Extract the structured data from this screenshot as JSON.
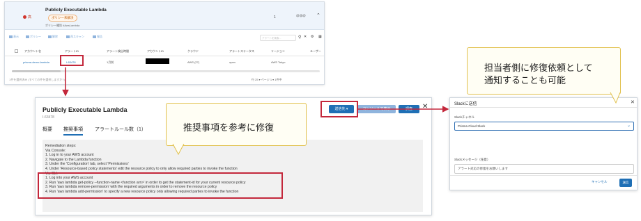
{
  "top_panel": {
    "header": {
      "severity_label": "高",
      "title": "Publicly Executable Lambda",
      "badge": "ポリシー未解決",
      "subline": "ポリシー種別 #AwsLambda",
      "count": "1",
      "count_badge": "@@@"
    },
    "toolbar": {
      "items": [
        "表示",
        "ポリシー",
        "解除",
        "再スキャン",
        "報告"
      ],
      "search_placeholder": "アラートを検索..."
    },
    "table": {
      "columns": [
        "アカウント名",
        "アラートID",
        "アラート検出時間",
        "アカウントID",
        "クラウド",
        "アラートステータス",
        "リージョン",
        "ユーザー"
      ],
      "row": {
        "account_name": "prisma-demo-lambda",
        "alert_id": "I-63478",
        "detected": "1月前",
        "cloud": "AWS (27)",
        "status": "open",
        "region": "AWS Tokyo"
      }
    },
    "footer": {
      "left": "1件を選択済み (すべての件を選択しますか?)",
      "right": "行 25 ▾  ページ  1 ▾  1件中"
    }
  },
  "main_panel": {
    "title": "Publicly Executable Lambda",
    "alert_id": "I-63478",
    "tabs": [
      "概要",
      "推奨事項",
      "アラートルール数（1）"
    ],
    "buttons": {
      "send": "送信先 ▾",
      "console": "コンソールで表示",
      "investigate": "調査",
      "close": "✕"
    },
    "remediation_lines": [
      "Remediation steps:",
      "Via Console:",
      "1. Log in to your AWS account",
      "2. Navigate to the Lambda function",
      "3. Under the 'Configuration' tab, select 'Permissions'",
      "4. Under 'Resource-based policy statements' edit the resource policy to only allow required parties to invoke the function",
      "Via CLI:",
      "1. Log into your AWS account",
      "2. Run 'aws lambda get-policy --function-name <function arn>' in order to get the statement-id for your current resource policy",
      "3. Run 'aws lambda remove-permission' with the required arguments in order to remove the resource policy",
      "4. Run 'aws lambda add-permission' to specify a new resource policy only allowing required parties to invoke the function"
    ]
  },
  "callouts": {
    "main": "推奨事項を参考に修復",
    "right_line1": "担当者側に修復依頼として",
    "right_line2": "通知することも可能"
  },
  "slack_dialog": {
    "title": "Slackに送信",
    "channel_label": "Slackチャネル",
    "channel_value": "Prisma Cloud Slack",
    "message_label": "Slackメッセージ（任意）",
    "message_value": "アラート対応の修復をお願いします",
    "cancel": "キャンセル",
    "submit": "送信"
  },
  "colors": {
    "accent": "#1f6fb5",
    "highlight": "#c3273b",
    "callout_border": "#e1c04c"
  }
}
